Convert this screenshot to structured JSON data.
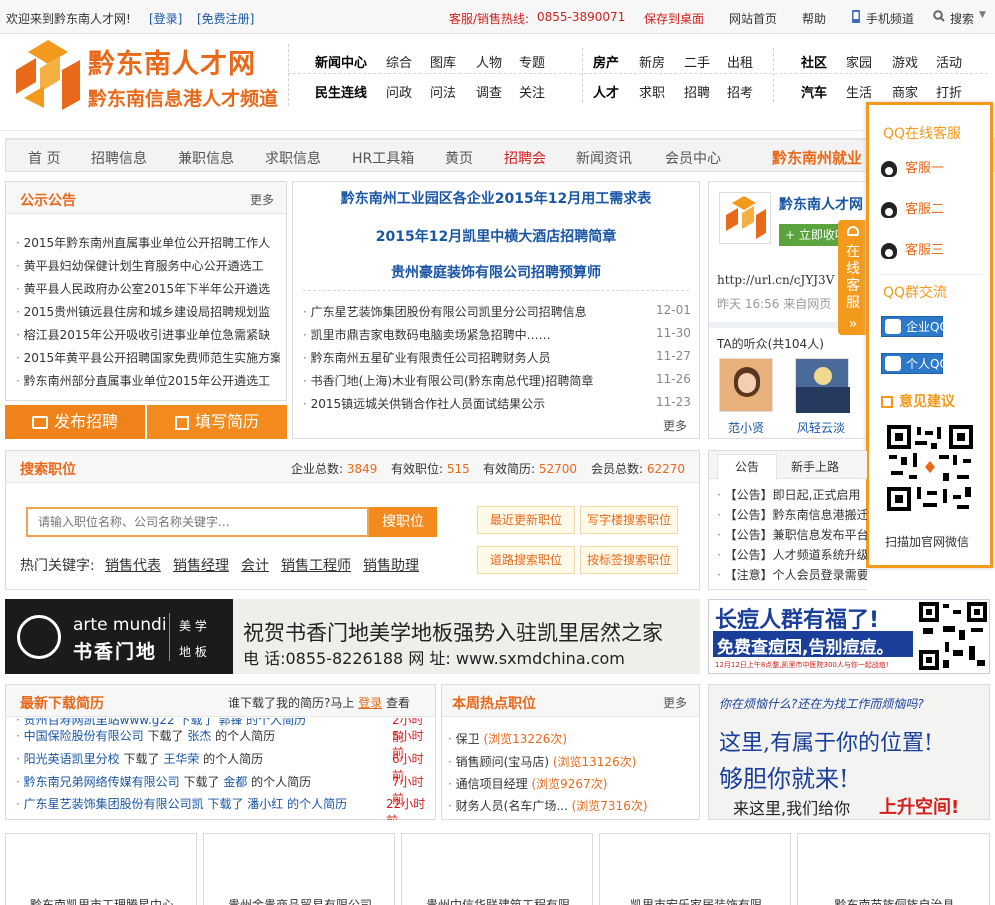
{
  "topbar": {
    "welcome": "欢迎来到黔东南人才网!",
    "login": "[登录]",
    "register": "[免费注册]",
    "hotline": "客服/销售热线:",
    "phone": "0855-3890071",
    "save_desktop": "保存到桌面",
    "site_home": "网站首页",
    "help": "帮助",
    "mobile": "手机频道",
    "search": "搜索"
  },
  "logo": {
    "name": "黔东南人才网",
    "subtitle": "黔东南信息港人才频道"
  },
  "topnav": {
    "row1": [
      "新闻中心",
      "综合",
      "图库",
      "人物",
      "专题",
      "房产",
      "新房",
      "二手",
      "出租",
      "社区",
      "家园",
      "游戏",
      "活动"
    ],
    "row2": [
      "民生连线",
      "问政",
      "问法",
      "调查",
      "关注",
      "人才",
      "求职",
      "招聘",
      "招考",
      "汽车",
      "生活",
      "商家",
      "打折"
    ]
  },
  "mainnav": [
    "首 页",
    "招聘信息",
    "兼职信息",
    "求职信息",
    "HR工具箱",
    "黄页",
    "招聘会",
    "新闻资讯",
    "会员中心"
  ],
  "mainnav_right": "黔东南州就业",
  "notice": {
    "title": "公示公告",
    "more": "更多",
    "items": [
      "2015年黔东南州直属事业单位公开招聘工作人",
      "黄平县妇幼保健计划生育服务中心公开遴选工",
      "黄平县人民政府办公室2015年下半年公开遴选",
      "2015贵州镇远县住房和城乡建设局招聘规划监",
      "榕江县2015年公开吸收引进事业单位急需紧缺",
      "2015年黄平县公开招聘国家免费师范生实施方案",
      "黔东南州部分直属事业单位2015年公开遴选工"
    ]
  },
  "actions": {
    "publish": "发布招聘",
    "resume": "填写简历"
  },
  "headlines": {
    "links": [
      "黔东南州工业园区各企业2015年12月用工需求表",
      "2015年12月凯里中横大酒店招聘简章",
      "贵州豪庭装饰有限公司招聘预算师"
    ],
    "items": [
      {
        "t": "广东星艺装饰集团股份有限公司凯里分公司招聘信息",
        "d": "12-01"
      },
      {
        "t": "凯里市鼎吉家电数码电脑卖场紧急招聘中……",
        "d": "11-30"
      },
      {
        "t": "黔东南州五星矿业有限责任公司招聘财务人员",
        "d": "11-27"
      },
      {
        "t": "书香门地(上海)木业有限公司(黔东南总代理)招聘简章",
        "d": "11-26"
      },
      {
        "t": "2015镇远城关供销合作社人员面试结果公示",
        "d": "11-23"
      }
    ],
    "more": "更多"
  },
  "weibo": {
    "name": "黔东南人才网",
    "follow": "立即收听",
    "text": "http://url.cn/cJYJ3V",
    "meta": "昨天 16:56 来自网页",
    "fans": "TA的听众(共104人)",
    "fan1": "范小贤",
    "fan2": "风轻云淡"
  },
  "qq": {
    "title": "QQ在线客服",
    "tab": "在线客服",
    "tab_arrow": "»",
    "agents": [
      "客服一",
      "客服二",
      "客服三"
    ],
    "group_title": "QQ群交流",
    "group1": "企业QQ群",
    "group2": "个人QQ群",
    "suggest": "意见建议",
    "wechat": "扫描加官网微信"
  },
  "search": {
    "title": "搜索职位",
    "stats": [
      {
        "label": "企业总数:",
        "value": "3849"
      },
      {
        "label": "有效职位:",
        "value": "515"
      },
      {
        "label": "有效简历:",
        "value": "52700"
      },
      {
        "label": "会员总数:",
        "value": "62270"
      }
    ],
    "placeholder": "请输入职位名称、公司名称关键字...",
    "button": "搜职位",
    "hot_label": "热门关键字:",
    "hot": [
      "销售代表",
      "销售经理",
      "会计",
      "销售工程师",
      "销售助理"
    ],
    "tags": [
      "最近更新职位",
      "写字楼搜索职位",
      "道路搜索职位",
      "按标签搜索职位"
    ]
  },
  "announce": {
    "tabs": [
      "公告",
      "新手上路"
    ],
    "items": [
      "【公告】即日起,正式启用",
      "【公告】黔东南信息港搬迁",
      "【公告】兼职信息发布平台",
      "【公告】人才频道系统升级",
      "【注意】个人会员登录需要激活问题的说"
    ]
  },
  "ads": {
    "artemundi_brand": "arte mundi",
    "artemundi_cn": "书香门地",
    "artemundi_tag1": "美 学",
    "artemundi_tag2": "地 板",
    "artemundi_line1": "祝贺书香门地美学地板强势入驻凯里居然之家",
    "artemundi_line2": "电 话:0855-8226188  网 址: www.sxmdchina.com",
    "acne_line1": "长痘人群有福了!",
    "acne_line2": "免费查痘因,告别痘痘。",
    "acne_line3": "12月12日上午8点整,凯里市中医院300人与你一起战痘!",
    "job_line1": "你在烦恼什么?还在为找工作而烦恼吗?",
    "job_line2": "这里,有属于你的位置!",
    "job_line3": "够胆你就来!",
    "job_line4": "来这里,我们给你",
    "job_line5": "上升空间!"
  },
  "downloads": {
    "title": "最新下载简历",
    "who": "谁下载了我的简历?马上",
    "login": "登录",
    "view": "查看",
    "items": [
      {
        "c": "中国保险股份有限公司",
        "p": "张杰",
        "t": "5小时前"
      },
      {
        "c": "阳光英语凯里分校",
        "p": "王华荣",
        "t": "6小时前"
      },
      {
        "c": "黔东南兄弟网络传媒有限公司",
        "p": "金都",
        "t": "7小时前"
      }
    ],
    "verb": "下载了",
    "suffix": "的个人简历",
    "top_partial": "贵州百寿网凯里站www.g22 下载了 郭锋 的个人简历",
    "top_time": "2小时前",
    "bottom_partial": "广东星艺装饰集团股份有限公司凯 下载了 潘小红 的个人简历",
    "bottom_time": "22小时前"
  },
  "hotjobs": {
    "title": "本周热点职位",
    "more": "更多",
    "items": [
      {
        "j": "保卫",
        "v": "(浏览13226次)"
      },
      {
        "j": "销售顾问(宝马店)",
        "v": "(浏览13126次)"
      },
      {
        "j": "通信项目经理",
        "v": "(浏览9267次)"
      },
      {
        "j": "财务人员(名车广场...",
        "v": "(浏览7316次)"
      }
    ]
  },
  "companies": [
    "黔东南凯里市工理腾星中心",
    "贵州金贵商品贸易有限公司",
    "贵州中信华联建筑工程有限",
    "凯里市宏乐家居装饰有限",
    "黔东南苗族侗族自治县"
  ]
}
